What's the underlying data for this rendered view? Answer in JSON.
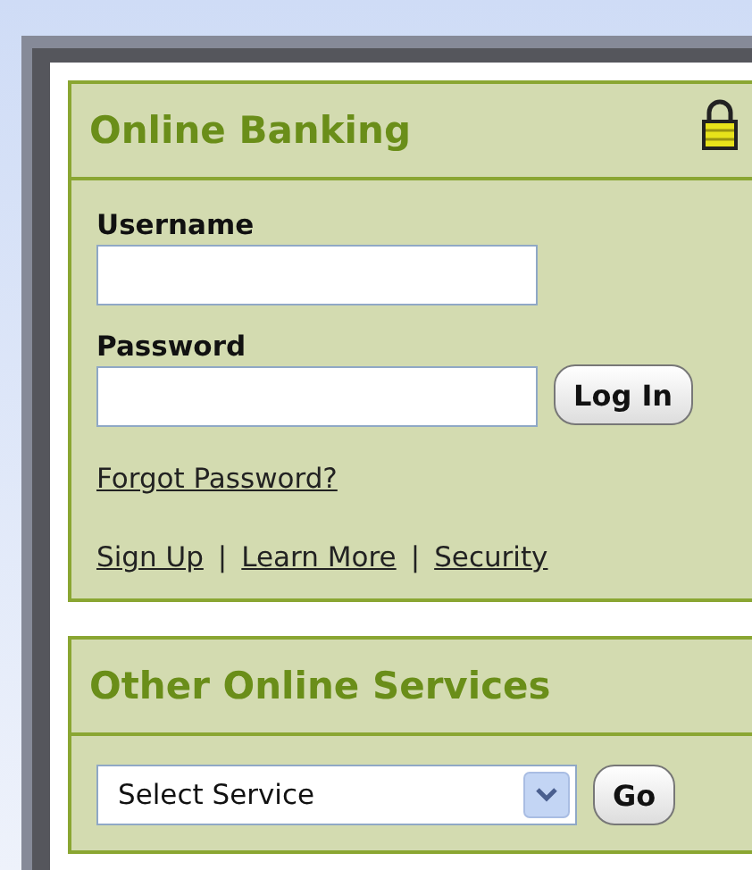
{
  "login_panel": {
    "title": "Online Banking",
    "username_label": "Username",
    "password_label": "Password",
    "login_button": "Log In",
    "forgot_link": "Forgot Password?",
    "links": [
      "Sign Up",
      "Learn More",
      "Security"
    ],
    "separator": "|"
  },
  "services_panel": {
    "title": "Other Online Services",
    "select_value": "Select Service",
    "go_button": "Go"
  }
}
